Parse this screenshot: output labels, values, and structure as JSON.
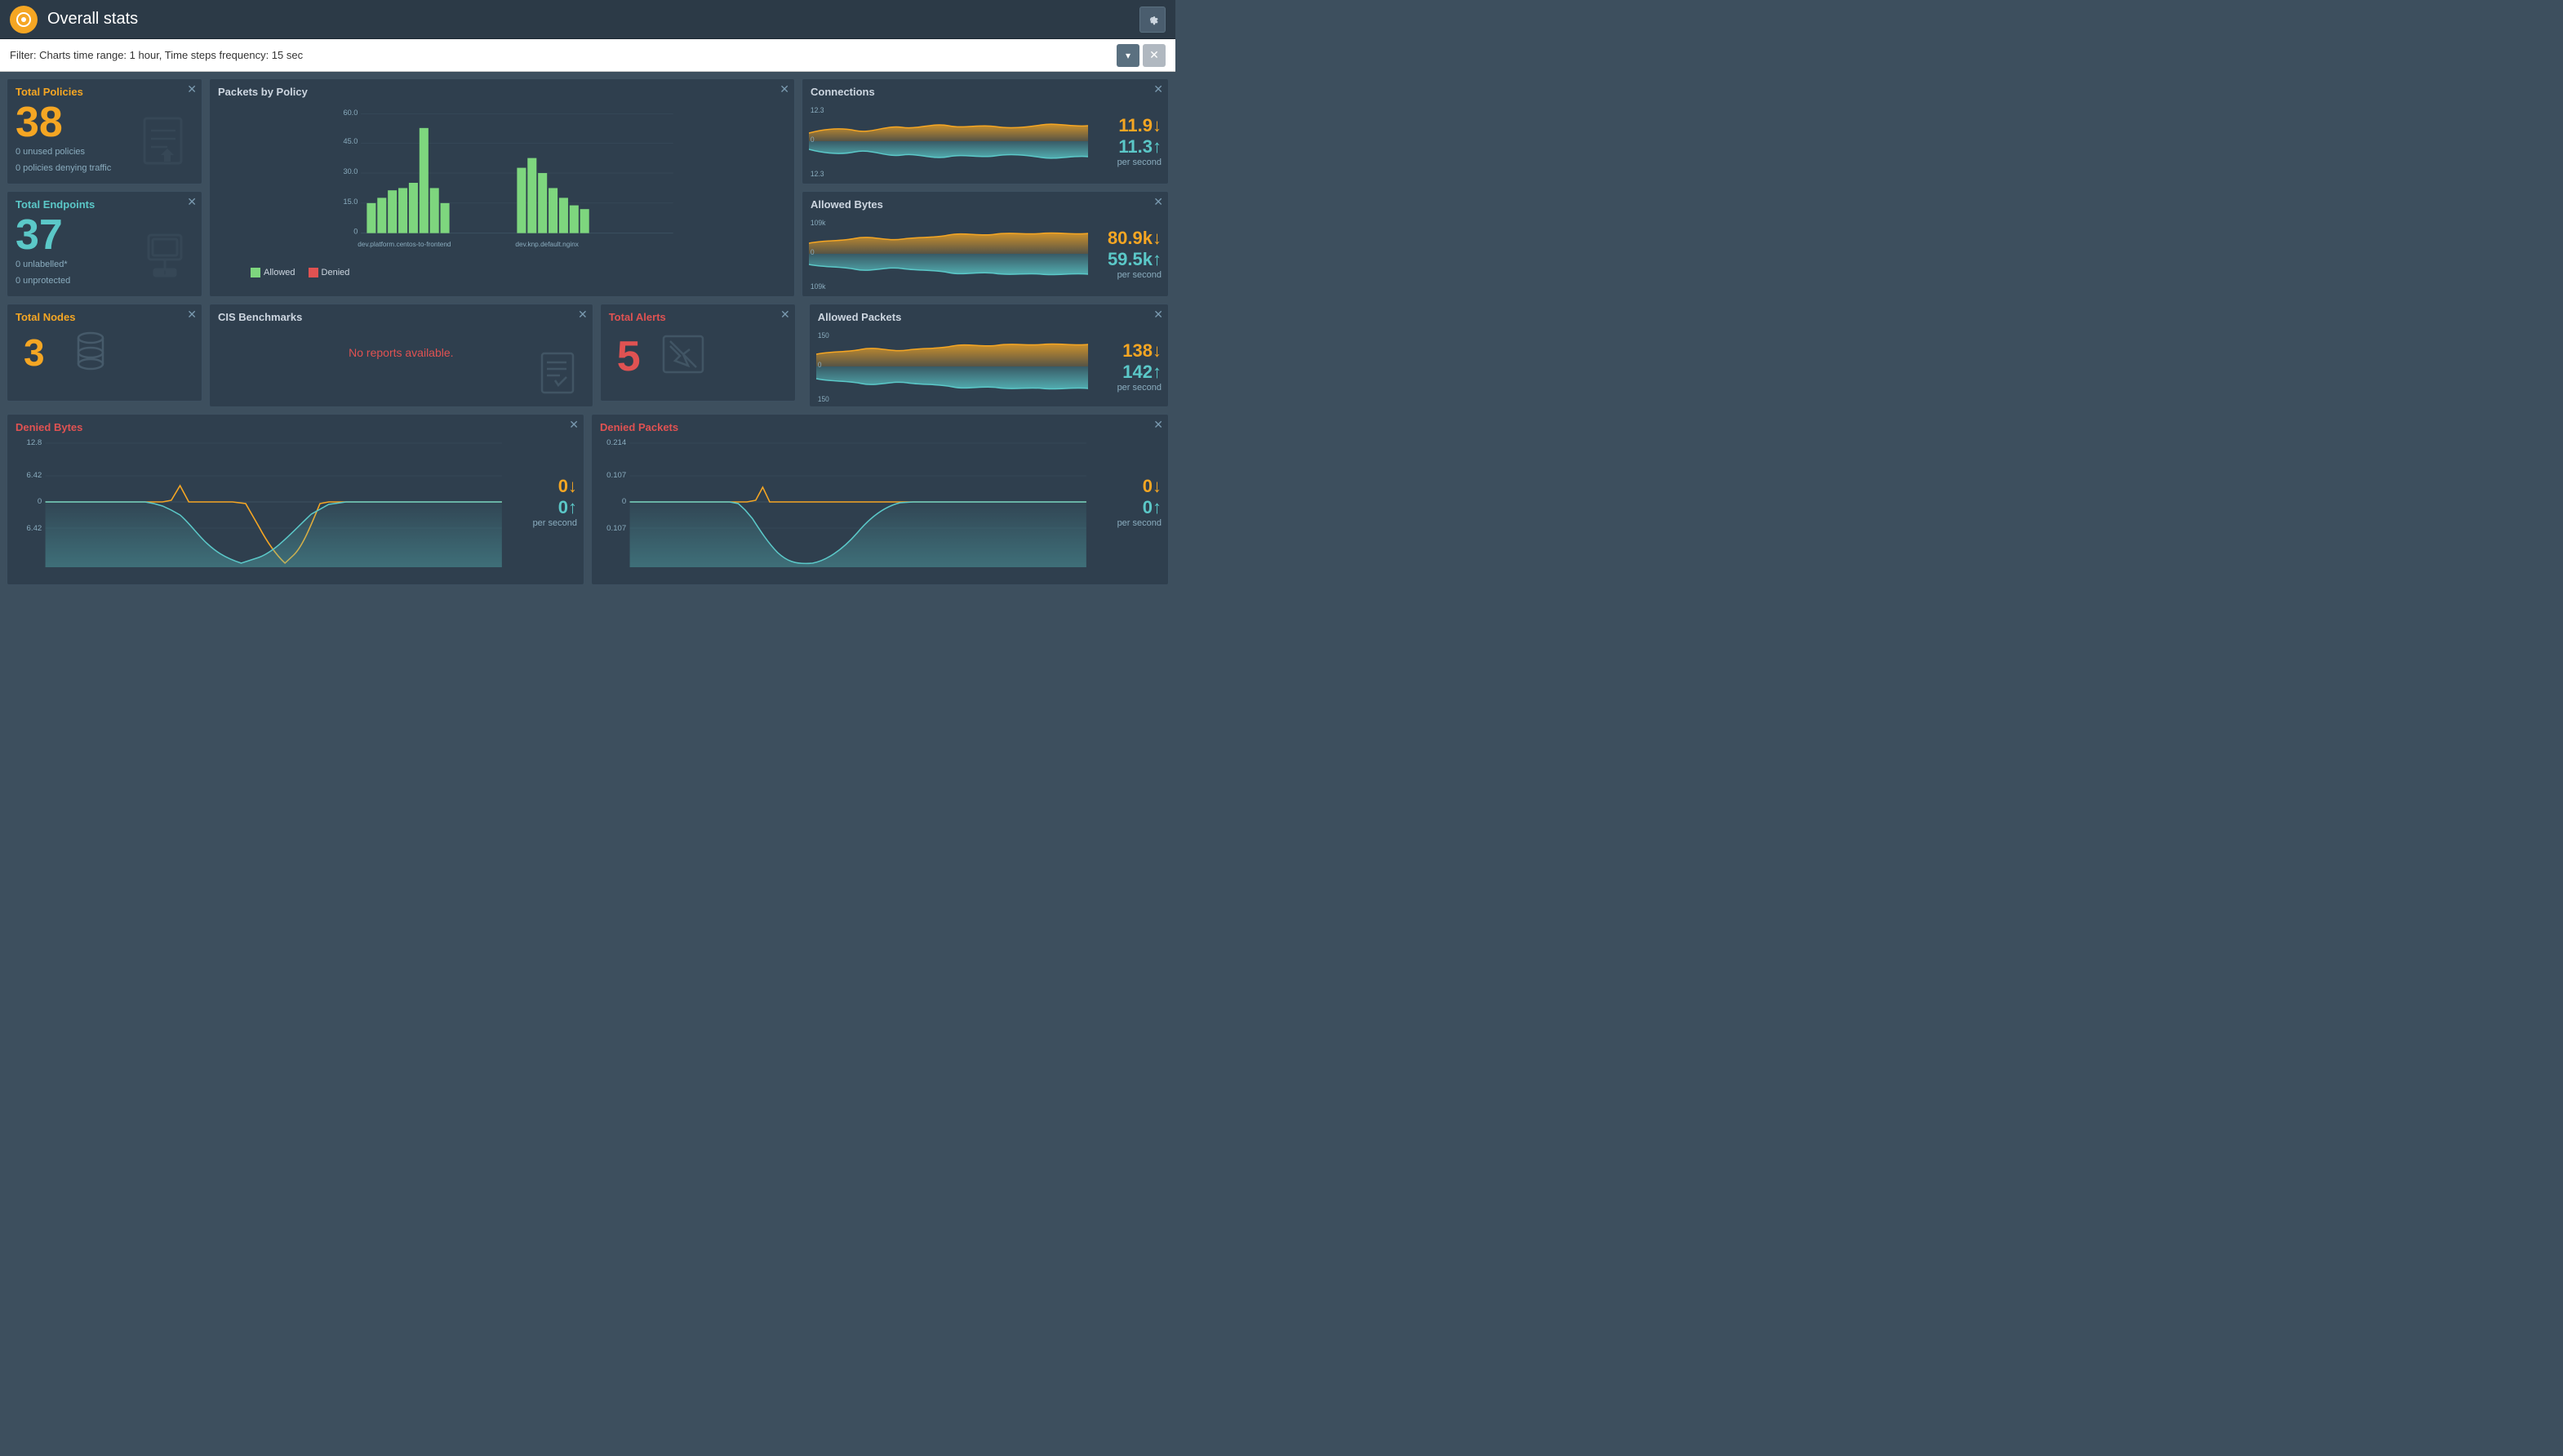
{
  "header": {
    "title": "Overall stats",
    "settings_icon": "⚙"
  },
  "filter": {
    "text": "Filter: Charts time range: 1 hour, Time steps frequency: 15 sec",
    "dropdown_icon": "▾",
    "close_icon": "✕"
  },
  "cards": {
    "total_policies": {
      "title": "Total Policies",
      "value": "38",
      "sub1": "0 unused policies",
      "sub2": "0 policies denying traffic"
    },
    "total_endpoints": {
      "title": "Total Endpoints",
      "value": "37",
      "sub1": "0 unlabelled*",
      "sub2": "0 unprotected"
    },
    "total_nodes": {
      "title": "Total Nodes",
      "value": "3"
    },
    "packets_by_policy": {
      "title": "Packets by Policy",
      "legend_allowed": "Allowed",
      "legend_denied": "Denied",
      "x_labels": [
        "dev.platform.centos-to-frontend",
        "dev.knp.default.nginx"
      ],
      "y_labels": [
        "60.0",
        "45.0",
        "30.0",
        "15.0",
        "0"
      ],
      "color_allowed": "#7ed67e",
      "color_denied": "#e05252"
    },
    "connections": {
      "title": "Connections",
      "value_down": "11.9↓",
      "value_up": "11.3↑",
      "per_second": "per second"
    },
    "allowed_bytes": {
      "title": "Allowed Bytes",
      "value_down": "80.9k↓",
      "value_up": "59.5k↑",
      "per_second": "per second",
      "y_top": "109k",
      "y_bottom": "109k"
    },
    "allowed_packets": {
      "title": "Allowed Packets",
      "value_down": "138↓",
      "value_up": "142↑",
      "per_second": "per second",
      "y_top": "150",
      "y_bottom": "150"
    },
    "cis_benchmarks": {
      "title": "CIS Benchmarks",
      "no_reports": "No reports available."
    },
    "total_alerts": {
      "title": "Total Alerts",
      "value": "5"
    },
    "denied_bytes": {
      "title": "Denied Bytes",
      "value_down": "0↓",
      "value_up": "0↑",
      "per_second": "per second",
      "y_top": "12.8",
      "y_mid": "6.42",
      "y_zero": "0",
      "y_neg": "6.42"
    },
    "denied_packets": {
      "title": "Denied Packets",
      "value_down": "0↓",
      "value_up": "0↑",
      "per_second": "per second",
      "y_top": "0.214",
      "y_mid": "0.107",
      "y_zero": "0",
      "y_neg": "0.107"
    }
  }
}
